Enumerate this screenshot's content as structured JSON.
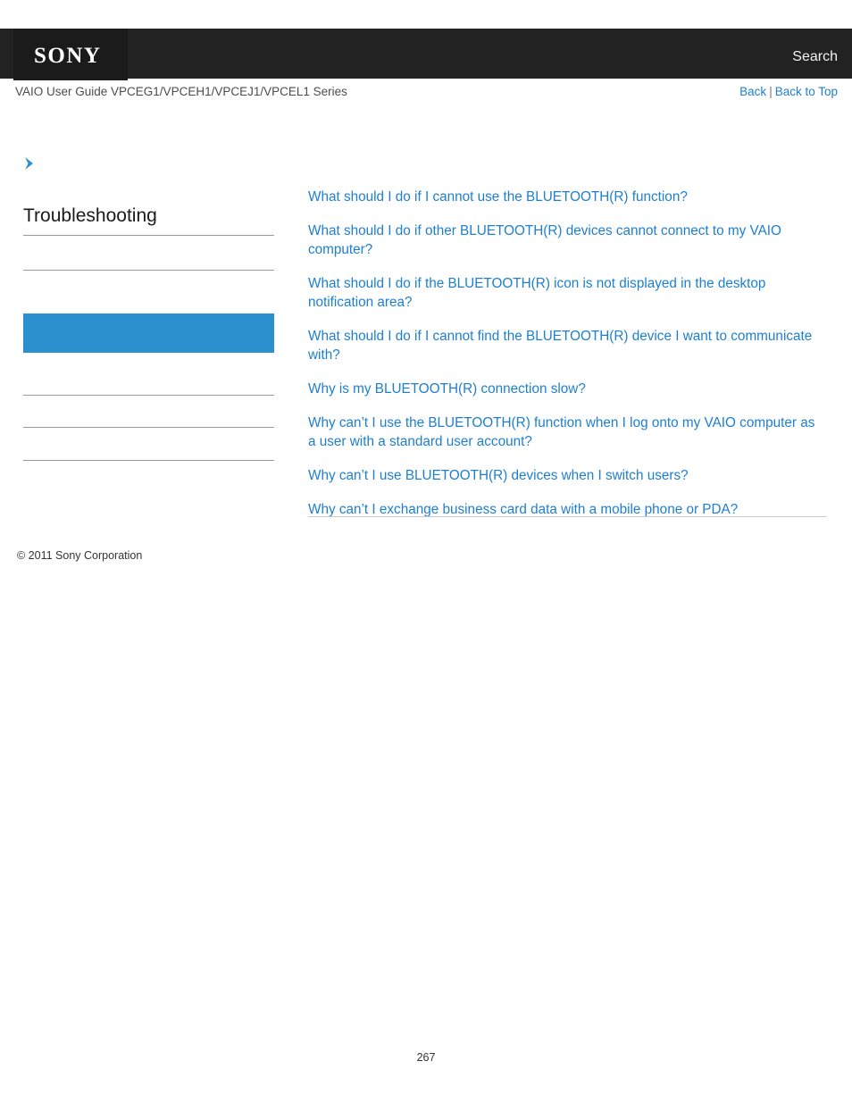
{
  "header": {
    "logo_text": "SONY",
    "search_label": "Search",
    "guide_title": "VAIO User Guide VPCEG1/VPCEH1/VPCEJ1/VPCEL1 Series",
    "back_label": "Back",
    "separator": "|",
    "back_to_top_label": "Back to Top",
    "bar_color": "#222222",
    "logo_box_color": "#1b1b1b",
    "link_color": "#1e7fd0"
  },
  "sidebar": {
    "arrow_icon": "chevron-right-icon",
    "title": "Troubleshooting",
    "highlight_color": "#2b90cd",
    "rule_color": "#9a9a9a",
    "items": [
      {
        "label": "",
        "selected": false
      },
      {
        "label": "",
        "selected": false
      },
      {
        "label": "",
        "selected": true
      },
      {
        "label": "",
        "selected": false
      },
      {
        "label": "",
        "selected": false
      },
      {
        "label": "",
        "selected": false
      }
    ]
  },
  "main": {
    "links": [
      "What should I do if I cannot use the BLUETOOTH(R) function?",
      "What should I do if other BLUETOOTH(R) devices cannot connect to my VAIO computer?",
      "What should I do if the BLUETOOTH(R) icon is not displayed in the desktop notification area?",
      "What should I do if I cannot find the BLUETOOTH(R) device I want to communicate with?",
      "Why is my BLUETOOTH(R) connection slow?",
      "Why can’t I use the BLUETOOTH(R) function when I log onto my VAIO computer as a user with a standard user account?",
      "Why can’t I use BLUETOOTH(R) devices when I switch users?",
      "Why can’t I exchange business card data with a mobile phone or PDA?"
    ],
    "link_color": "#1e7fd0"
  },
  "footer": {
    "copyright": "© 2011 Sony Corporation",
    "page_number": "267"
  }
}
